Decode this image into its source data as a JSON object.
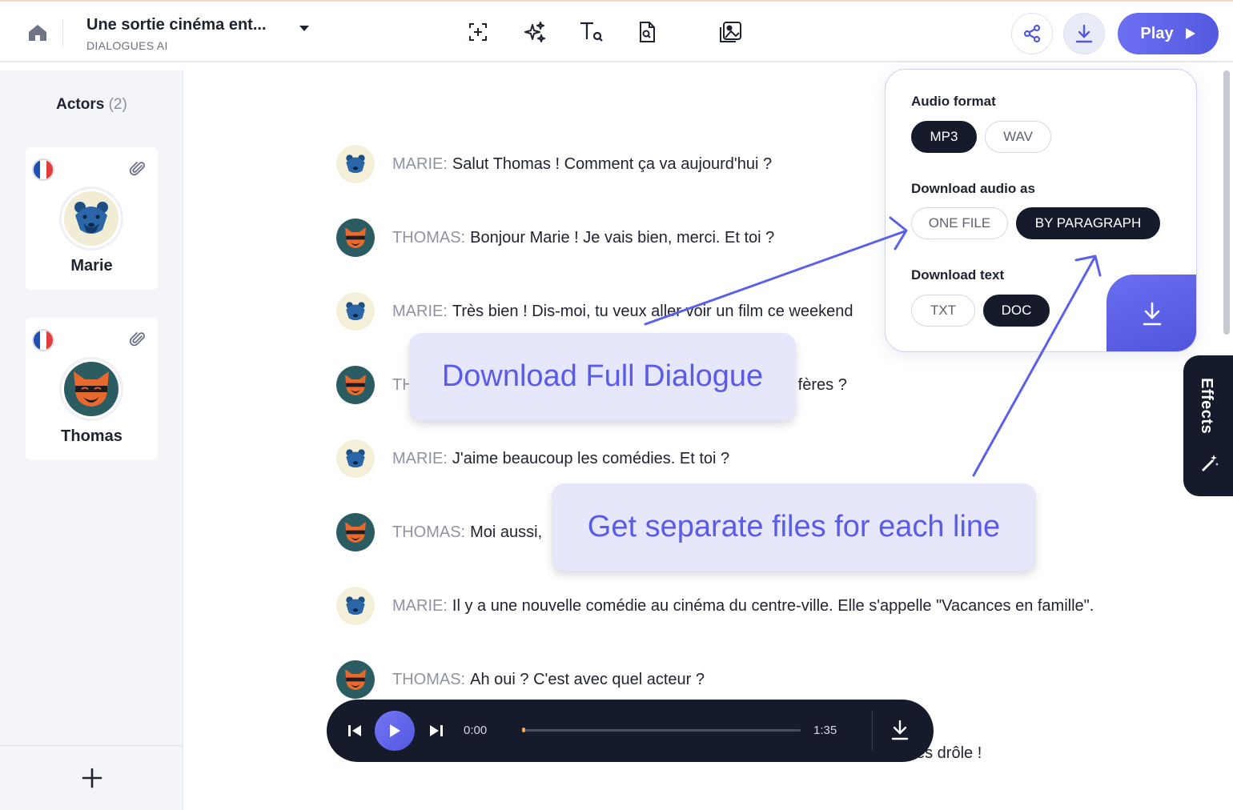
{
  "header": {
    "title": "Une sortie cinéma ent...",
    "subtitle": "DIALOGUES AI",
    "play_label": "Play"
  },
  "sidebar": {
    "actors_heading": "Actors",
    "actors_count": "(2)",
    "actors": [
      {
        "name": "Marie",
        "avatar": "blue-bear-icon",
        "language": "french-flag-icon"
      },
      {
        "name": "Thomas",
        "avatar": "fox-icon",
        "language": "french-flag-icon"
      }
    ]
  },
  "dialogue": [
    {
      "speaker": "MARIE:",
      "text": "Salut Thomas ! Comment ça va aujourd'hui ?"
    },
    {
      "speaker": "THOMAS:",
      "text": "Bonjour Marie ! Je vais bien, merci. Et toi ?"
    },
    {
      "speaker": "MARIE:",
      "text": "Très bien ! Dis-moi, tu veux aller voir un film ce weekend"
    },
    {
      "speaker": "TH",
      "text": "fères ?"
    },
    {
      "speaker": "MARIE:",
      "text": "J'aime beaucoup les comédies. Et toi ?"
    },
    {
      "speaker": "THOMAS:",
      "text": "Moi aussi,"
    },
    {
      "speaker": "MARIE:",
      "text": "Il y a une nouvelle comédie au cinéma du centre-ville. Elle s'appelle \"Vacances en famille\"."
    },
    {
      "speaker": "THOMAS:",
      "text": "Ah oui ? C'est avec quel acteur ?"
    },
    {
      "speaker": "",
      "text": "es drôle !"
    }
  ],
  "download_panel": {
    "audio_format_label": "Audio format",
    "audio_formats": [
      "MP3",
      "WAV"
    ],
    "audio_format_selected": "MP3",
    "download_audio_as_label": "Download audio as",
    "audio_modes": [
      "ONE FILE",
      "BY PARAGRAPH"
    ],
    "audio_mode_selected": "BY PARAGRAPH",
    "download_text_label": "Download text",
    "text_formats": [
      "TXT",
      "DOC"
    ],
    "text_format_selected": "DOC"
  },
  "callouts": {
    "full_dialogue": "Download Full Dialogue",
    "separate_files": "Get separate files for each line"
  },
  "effects_label": "Effects",
  "player": {
    "current_time": "0:00",
    "duration": "1:35",
    "progress": 0.0
  },
  "colors": {
    "accent": "#5c60e8",
    "dark": "#161b2c",
    "callout_bg": "#e6e7fb"
  }
}
